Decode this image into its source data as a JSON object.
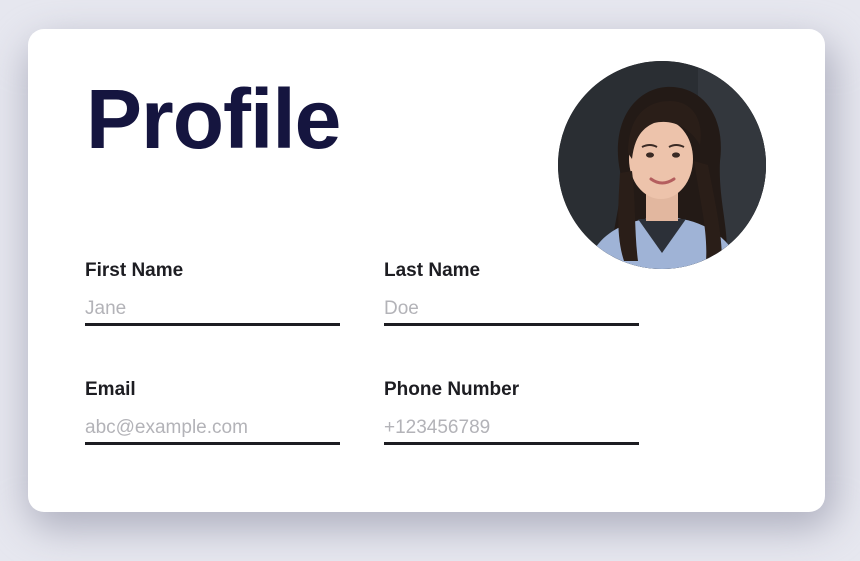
{
  "profile": {
    "title": "Profile",
    "avatar_alt": "Profile photo",
    "fields": {
      "first_name": {
        "label": "First Name",
        "placeholder": "Jane",
        "value": ""
      },
      "last_name": {
        "label": "Last Name",
        "placeholder": "Doe",
        "value": ""
      },
      "email": {
        "label": "Email",
        "placeholder": "abc@example.com",
        "value": ""
      },
      "phone": {
        "label": "Phone Number",
        "placeholder": "+123456789",
        "value": ""
      }
    }
  },
  "colors": {
    "title": "#15153f",
    "label": "#1d1d22",
    "placeholder": "#b3b3b8",
    "card": "#ffffff",
    "background": "#e6e7ef"
  }
}
